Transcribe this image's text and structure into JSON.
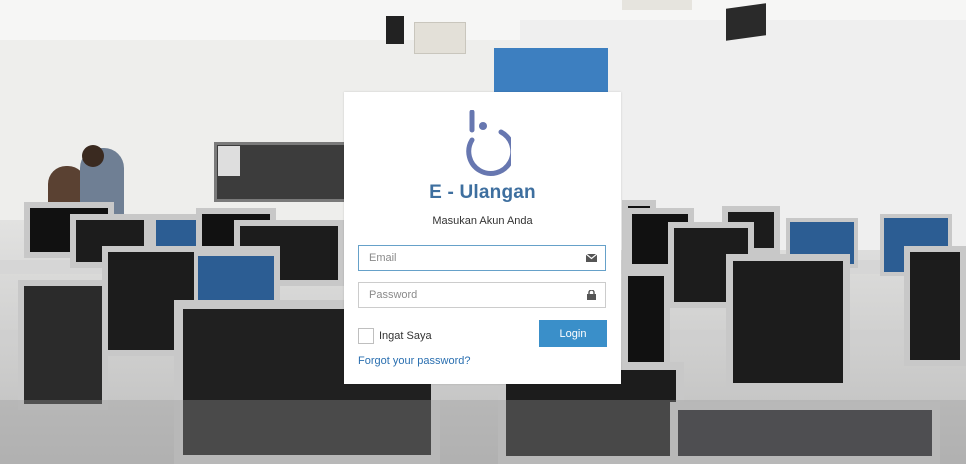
{
  "login": {
    "brand": "E - Ulangan",
    "subtitle": "Masukan Akun Anda",
    "email_placeholder": "Email",
    "password_placeholder": "Password",
    "remember_label": "Ingat Saya",
    "login_label": "Login",
    "forgot_label": "Forgot your password?",
    "email_icon": "envelope-icon",
    "password_icon": "lock-icon",
    "logo_icon": "power-b-logo-icon"
  },
  "colors": {
    "brand": "#3e6f9f",
    "logo": "#6777b0",
    "button": "#3a8fc9",
    "link": "#2a6fb0"
  }
}
